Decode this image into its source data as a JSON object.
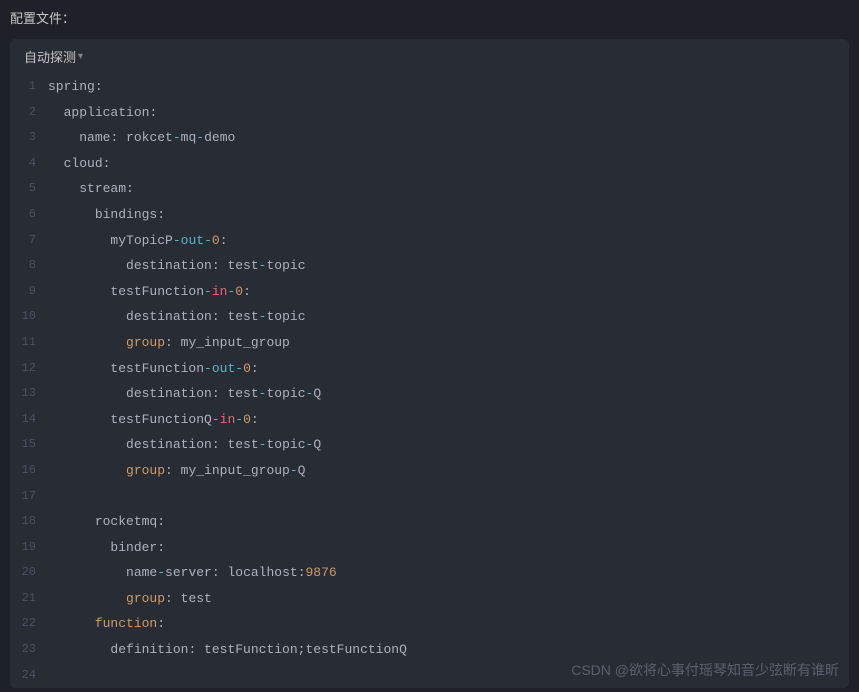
{
  "header": {
    "title": "配置文件："
  },
  "toolbar": {
    "lang_detect": "自动探测"
  },
  "watermark": "CSDN @欲将心事付瑶琴知音少弦断有谁昕",
  "code": {
    "lines": [
      [
        {
          "t": "key",
          "v": "spring"
        },
        {
          "t": "punc",
          "v": ":"
        }
      ],
      [
        {
          "t": "ind",
          "v": "  "
        },
        {
          "t": "key",
          "v": "application"
        },
        {
          "t": "punc",
          "v": ":"
        }
      ],
      [
        {
          "t": "ind",
          "v": "    "
        },
        {
          "t": "key",
          "v": "name"
        },
        {
          "t": "punc",
          "v": ": "
        },
        {
          "t": "str",
          "v": "rokcet"
        },
        {
          "t": "dash",
          "v": "-"
        },
        {
          "t": "str",
          "v": "mq"
        },
        {
          "t": "dash",
          "v": "-"
        },
        {
          "t": "str",
          "v": "demo"
        }
      ],
      [
        {
          "t": "ind",
          "v": "  "
        },
        {
          "t": "key",
          "v": "cloud"
        },
        {
          "t": "punc",
          "v": ":"
        }
      ],
      [
        {
          "t": "ind",
          "v": "    "
        },
        {
          "t": "key",
          "v": "stream"
        },
        {
          "t": "punc",
          "v": ":"
        }
      ],
      [
        {
          "t": "ind",
          "v": "      "
        },
        {
          "t": "key",
          "v": "bindings"
        },
        {
          "t": "punc",
          "v": ":"
        }
      ],
      [
        {
          "t": "ind",
          "v": "        "
        },
        {
          "t": "key",
          "v": "myTopicP"
        },
        {
          "t": "dash",
          "v": "-"
        },
        {
          "t": "cyan",
          "v": "out"
        },
        {
          "t": "dash",
          "v": "-"
        },
        {
          "t": "attr",
          "v": "0"
        },
        {
          "t": "punc",
          "v": ":"
        }
      ],
      [
        {
          "t": "ind",
          "v": "          "
        },
        {
          "t": "key",
          "v": "destination"
        },
        {
          "t": "punc",
          "v": ": "
        },
        {
          "t": "str",
          "v": "test"
        },
        {
          "t": "dash",
          "v": "-"
        },
        {
          "t": "str",
          "v": "topic"
        }
      ],
      [
        {
          "t": "ind",
          "v": "        "
        },
        {
          "t": "key",
          "v": "testFunction"
        },
        {
          "t": "dash",
          "v": "-"
        },
        {
          "t": "red",
          "v": "in"
        },
        {
          "t": "dash",
          "v": "-"
        },
        {
          "t": "attr",
          "v": "0"
        },
        {
          "t": "punc",
          "v": ":"
        }
      ],
      [
        {
          "t": "ind",
          "v": "          "
        },
        {
          "t": "key",
          "v": "destination"
        },
        {
          "t": "punc",
          "v": ": "
        },
        {
          "t": "str",
          "v": "test"
        },
        {
          "t": "dash",
          "v": "-"
        },
        {
          "t": "str",
          "v": "topic"
        }
      ],
      [
        {
          "t": "ind",
          "v": "          "
        },
        {
          "t": "attr",
          "v": "group"
        },
        {
          "t": "punc",
          "v": ": "
        },
        {
          "t": "str",
          "v": "my_input_group"
        }
      ],
      [
        {
          "t": "ind",
          "v": "        "
        },
        {
          "t": "key",
          "v": "testFunction"
        },
        {
          "t": "dash",
          "v": "-"
        },
        {
          "t": "cyan",
          "v": "out"
        },
        {
          "t": "dash",
          "v": "-"
        },
        {
          "t": "attr",
          "v": "0"
        },
        {
          "t": "punc",
          "v": ":"
        }
      ],
      [
        {
          "t": "ind",
          "v": "          "
        },
        {
          "t": "key",
          "v": "destination"
        },
        {
          "t": "punc",
          "v": ": "
        },
        {
          "t": "str",
          "v": "test"
        },
        {
          "t": "dash",
          "v": "-"
        },
        {
          "t": "str",
          "v": "topic"
        },
        {
          "t": "dash",
          "v": "-"
        },
        {
          "t": "str",
          "v": "Q"
        }
      ],
      [
        {
          "t": "ind",
          "v": "        "
        },
        {
          "t": "key",
          "v": "testFunctionQ"
        },
        {
          "t": "dash",
          "v": "-"
        },
        {
          "t": "red",
          "v": "in"
        },
        {
          "t": "dash",
          "v": "-"
        },
        {
          "t": "attr",
          "v": "0"
        },
        {
          "t": "punc",
          "v": ":"
        }
      ],
      [
        {
          "t": "ind",
          "v": "          "
        },
        {
          "t": "key",
          "v": "destination"
        },
        {
          "t": "punc",
          "v": ": "
        },
        {
          "t": "str",
          "v": "test"
        },
        {
          "t": "dash",
          "v": "-"
        },
        {
          "t": "str",
          "v": "topic"
        },
        {
          "t": "dash",
          "v": "-"
        },
        {
          "t": "str",
          "v": "Q"
        }
      ],
      [
        {
          "t": "ind",
          "v": "          "
        },
        {
          "t": "attr",
          "v": "group"
        },
        {
          "t": "punc",
          "v": ": "
        },
        {
          "t": "str",
          "v": "my_input_group"
        },
        {
          "t": "dash",
          "v": "-"
        },
        {
          "t": "str",
          "v": "Q"
        }
      ],
      [],
      [
        {
          "t": "ind",
          "v": "      "
        },
        {
          "t": "key",
          "v": "rocketmq"
        },
        {
          "t": "punc",
          "v": ":"
        }
      ],
      [
        {
          "t": "ind",
          "v": "        "
        },
        {
          "t": "key",
          "v": "binder"
        },
        {
          "t": "punc",
          "v": ":"
        }
      ],
      [
        {
          "t": "ind",
          "v": "          "
        },
        {
          "t": "key",
          "v": "name"
        },
        {
          "t": "dash",
          "v": "-"
        },
        {
          "t": "key",
          "v": "server"
        },
        {
          "t": "punc",
          "v": ": "
        },
        {
          "t": "str",
          "v": "localhost"
        },
        {
          "t": "punc",
          "v": ":"
        },
        {
          "t": "num",
          "v": "9876"
        }
      ],
      [
        {
          "t": "ind",
          "v": "          "
        },
        {
          "t": "attr",
          "v": "group"
        },
        {
          "t": "punc",
          "v": ": "
        },
        {
          "t": "str",
          "v": "test"
        }
      ],
      [
        {
          "t": "ind",
          "v": "      "
        },
        {
          "t": "attr",
          "v": "function"
        },
        {
          "t": "punc",
          "v": ":"
        }
      ],
      [
        {
          "t": "ind",
          "v": "        "
        },
        {
          "t": "key",
          "v": "definition"
        },
        {
          "t": "punc",
          "v": ": "
        },
        {
          "t": "str",
          "v": "testFunction;testFunctionQ"
        }
      ],
      []
    ]
  }
}
